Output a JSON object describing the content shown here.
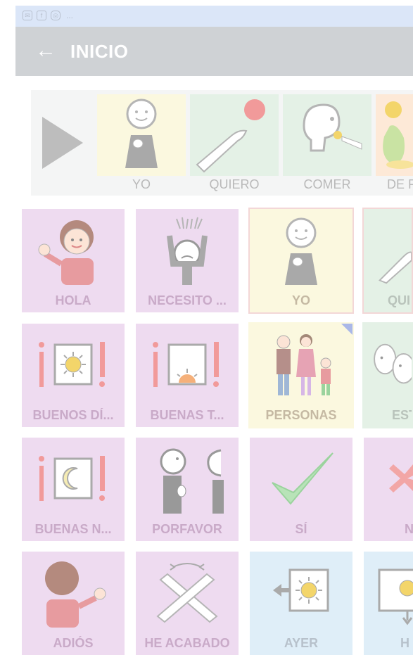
{
  "status_bar": {
    "icons": [
      "mail-icon",
      "facebook-icon",
      "instagram-icon"
    ],
    "more": "..."
  },
  "app_bar": {
    "back_glyph": "←",
    "title": "INICIO"
  },
  "sentence": {
    "words": [
      {
        "label": "YO",
        "bg": "#fbf8df"
      },
      {
        "label": "QUIERO",
        "bg": "#e4f1e6"
      },
      {
        "label": "COMER",
        "bg": "#e4f1e6"
      },
      {
        "label": "DE F",
        "bg": "#fde9d7"
      }
    ]
  },
  "grid": {
    "rows": [
      [
        {
          "label": "HOLA",
          "color": "purple"
        },
        {
          "label": "NECESITO ...",
          "color": "purple"
        },
        {
          "label": "YO",
          "color": "yellow"
        },
        {
          "label": "QUI",
          "color": "green"
        }
      ],
      [
        {
          "label": "BUENOS DÍ...",
          "color": "purple"
        },
        {
          "label": "BUENAS T...",
          "color": "purple"
        },
        {
          "label": "PERSONAS",
          "color": "yellow"
        },
        {
          "label": "EST",
          "color": "green"
        }
      ],
      [
        {
          "label": "BUENAS N...",
          "color": "purple"
        },
        {
          "label": "PORFAVOR",
          "color": "purple"
        },
        {
          "label": "SÍ",
          "color": "purple"
        },
        {
          "label": "N",
          "color": "purple"
        }
      ],
      [
        {
          "label": "ADIÓS",
          "color": "purple"
        },
        {
          "label": "HE ACABADO",
          "color": "purple"
        },
        {
          "label": "AYER",
          "color": "blue"
        },
        {
          "label": "H",
          "color": "blue"
        }
      ]
    ]
  },
  "colors": {
    "accent_red": "#f19a9a",
    "sun": "#f3d56a",
    "check_green": "#9ad39d",
    "cross_red": "#f2a6a6"
  }
}
